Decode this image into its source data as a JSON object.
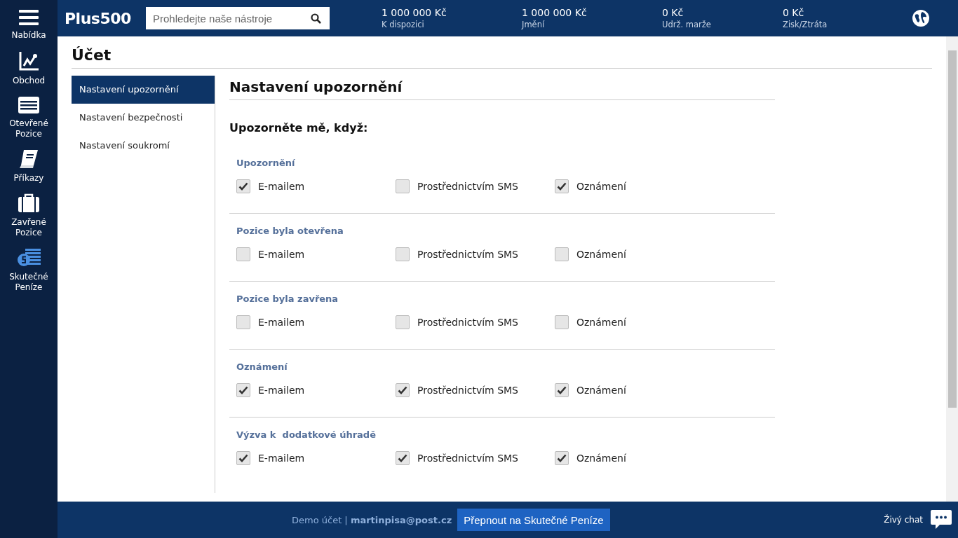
{
  "nav": [
    {
      "kind": "menu",
      "label": "Nabídka"
    },
    {
      "kind": "chart",
      "label": "Obchod"
    },
    {
      "kind": "list",
      "label": "Otevřené Pozice"
    },
    {
      "kind": "book",
      "label": "Příkazy"
    },
    {
      "kind": "case",
      "label": "Zavřené Pozice"
    },
    {
      "kind": "money",
      "label": "Skutečné Peníze"
    }
  ],
  "logo": "Plus500",
  "search": {
    "placeholder": "Prohledejte naše nástroje"
  },
  "stats": [
    {
      "value": "1 000 000 Kč",
      "label": "K dispozici"
    },
    {
      "value": "1 000 000 Kč",
      "label": "Jmění"
    },
    {
      "value": "0 Kč",
      "label": "Udrž. marže"
    },
    {
      "value": "0 Kč",
      "label": "Zisk/Ztráta"
    }
  ],
  "page_title": "Účet",
  "menu": [
    {
      "label": "Nastavení upozornění",
      "selected": true
    },
    {
      "label": "Nastavení bezpečnosti",
      "selected": false
    },
    {
      "label": "Nastavení soukromí",
      "selected": false
    }
  ],
  "panel_title": "Nastavení upozornění",
  "subtitle": "Upozorněte mě, když:",
  "groups": [
    {
      "title": "Upozornění",
      "options": [
        {
          "label": "E-mailem",
          "checked": true
        },
        {
          "label": "Prostřednictvím SMS",
          "checked": false
        },
        {
          "label": "Oznámení",
          "checked": true
        }
      ]
    },
    {
      "title": "Pozice byla otevřena",
      "options": [
        {
          "label": "E-mailem",
          "checked": false
        },
        {
          "label": "Prostřednictvím SMS",
          "checked": false
        },
        {
          "label": "Oznámení",
          "checked": false
        }
      ]
    },
    {
      "title": "Pozice byla zavřena",
      "options": [
        {
          "label": "E-mailem",
          "checked": false
        },
        {
          "label": "Prostřednictvím SMS",
          "checked": false
        },
        {
          "label": "Oznámení",
          "checked": false
        }
      ]
    },
    {
      "title": "Oznámení",
      "options": [
        {
          "label": "E-mailem",
          "checked": true
        },
        {
          "label": "Prostřednictvím SMS",
          "checked": true
        },
        {
          "label": "Oznámení",
          "checked": true
        }
      ]
    },
    {
      "title": "Výzva k  dodatkové úhradě",
      "options": [
        {
          "label": "E-mailem",
          "checked": true
        },
        {
          "label": "Prostřednictvím SMS",
          "checked": true
        },
        {
          "label": "Oznámení",
          "checked": true
        }
      ]
    }
  ],
  "footer": {
    "account": "Demo účet | **martinpisa@post.cz**",
    "switch_button": "Přepnout na Skutečné Peníze",
    "chat": "Živý chat"
  }
}
